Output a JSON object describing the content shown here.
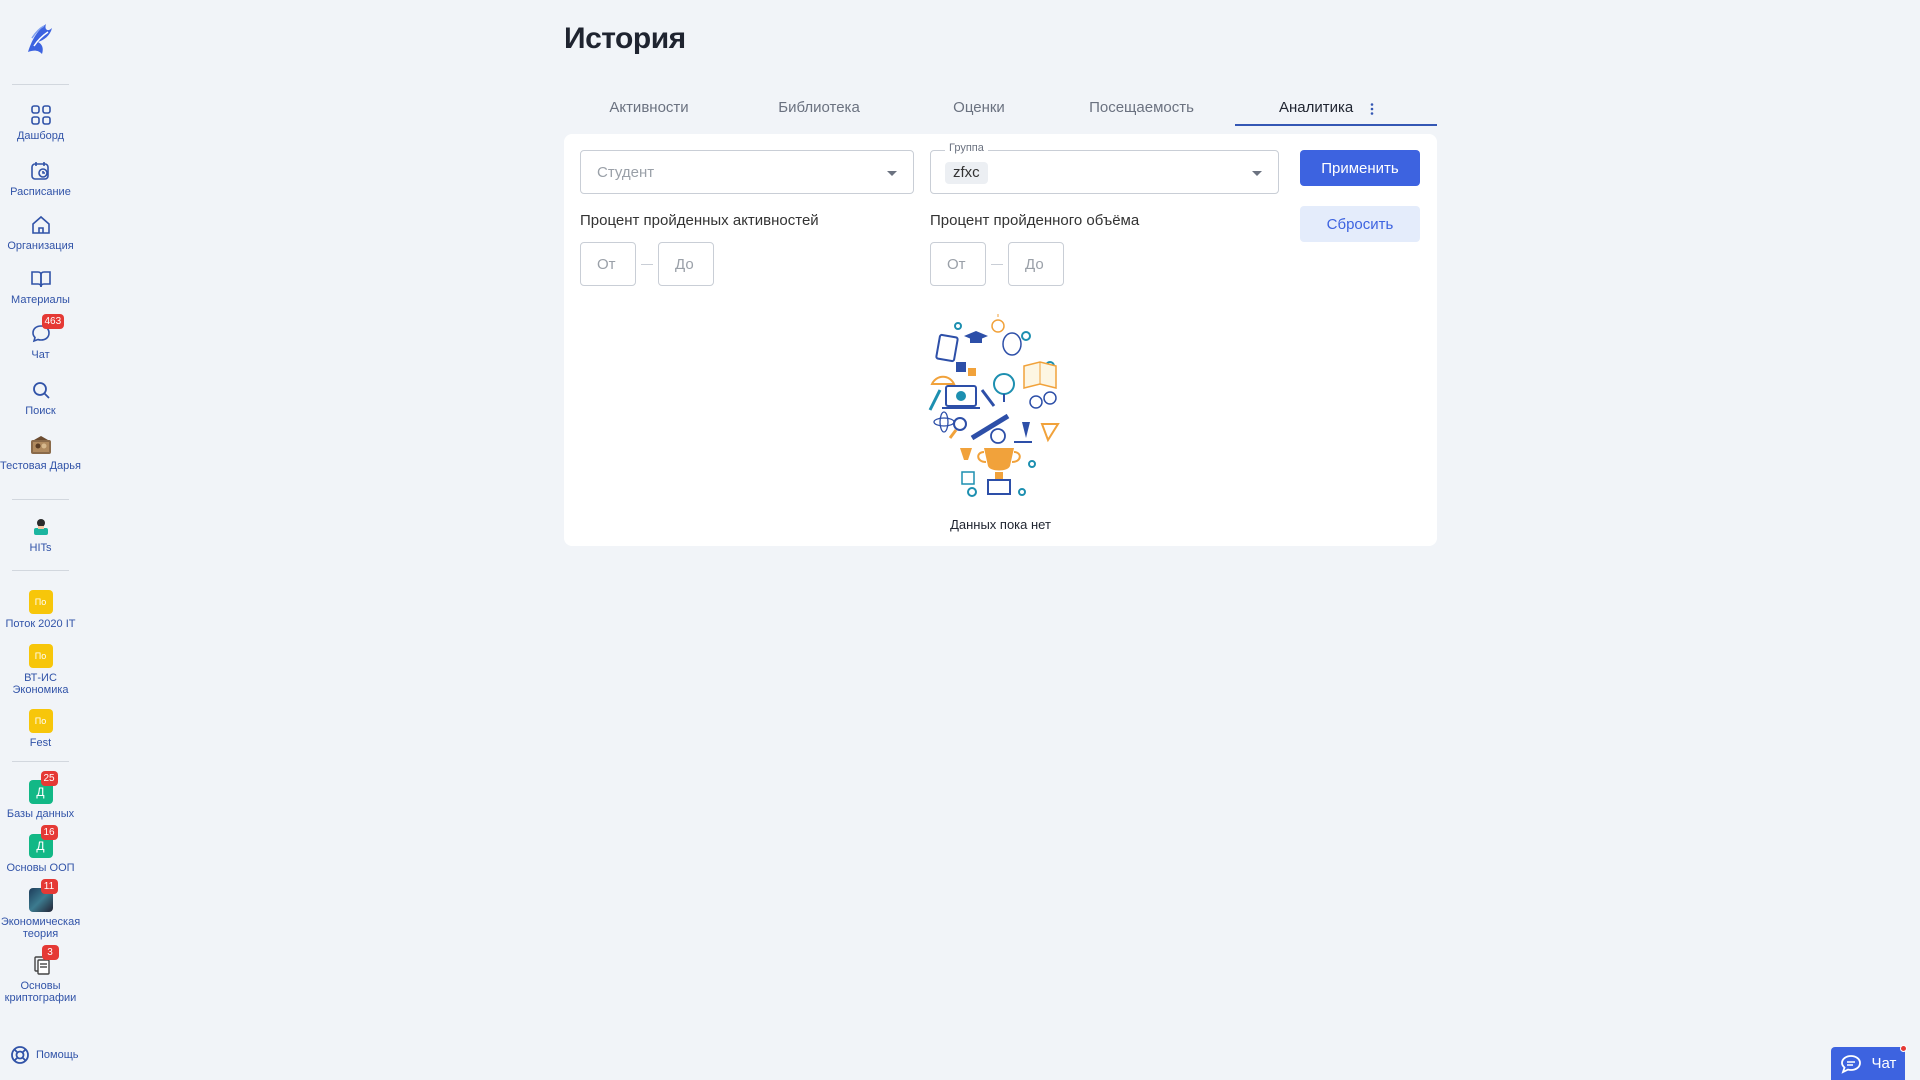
{
  "sidebar": {
    "items": [
      {
        "label": "Дашборд",
        "icon": "grid-icon"
      },
      {
        "label": "Расписание",
        "icon": "calendar-clock-icon"
      },
      {
        "label": "Организация",
        "icon": "home-icon"
      },
      {
        "label": "Материалы",
        "icon": "book-icon"
      },
      {
        "label": "Чат",
        "icon": "chat-icon",
        "badge": "463"
      },
      {
        "label": "Поиск",
        "icon": "search-icon"
      },
      {
        "label": "Тестовая Дарья",
        "icon": "avatar-image"
      },
      {
        "label": "HITs",
        "icon": "hits-logo"
      },
      {
        "label": "Поток 2020 IT",
        "initials": "По",
        "color": "#f7c60a"
      },
      {
        "label": "ВТ-ИС Экономика",
        "initials": "По",
        "color": "#f7c60a"
      },
      {
        "label": "Fest",
        "initials": "По",
        "color": "#f7c60a"
      },
      {
        "label": "Базы данных",
        "initials": "Д",
        "color": "#12b886",
        "badge": "25"
      },
      {
        "label": "Основы ООП",
        "initials": "Д",
        "color": "#12b886",
        "badge": "16"
      },
      {
        "label": "Экономическая теория",
        "icon": "course-image",
        "badge": "11"
      },
      {
        "label": "Основы криптографии",
        "icon": "documents-icon",
        "badge": "3"
      }
    ],
    "help_label": "Помощь"
  },
  "page": {
    "title": "История"
  },
  "tabs": [
    {
      "label": "Активности"
    },
    {
      "label": "Библиотека"
    },
    {
      "label": "Оценки"
    },
    {
      "label": "Посещаемость"
    },
    {
      "label": "Аналитика",
      "active": true
    }
  ],
  "filters": {
    "student": {
      "placeholder": "Студент"
    },
    "group": {
      "label": "Группа",
      "value": "zfxc"
    },
    "apply_label": "Применить",
    "reset_label": "Сбросить",
    "activities_range": {
      "label": "Процент пройденных активностей",
      "from_placeholder": "От",
      "to_placeholder": "До"
    },
    "volume_range": {
      "label": "Процент пройденного объёма",
      "from_placeholder": "От",
      "to_placeholder": "До"
    }
  },
  "empty_state": {
    "text": "Данных пока нет"
  },
  "chat_widget": {
    "label": "Чат"
  },
  "colors": {
    "accent": "#3d63e0",
    "badge": "#e53935",
    "brand_text": "#3153a8"
  }
}
